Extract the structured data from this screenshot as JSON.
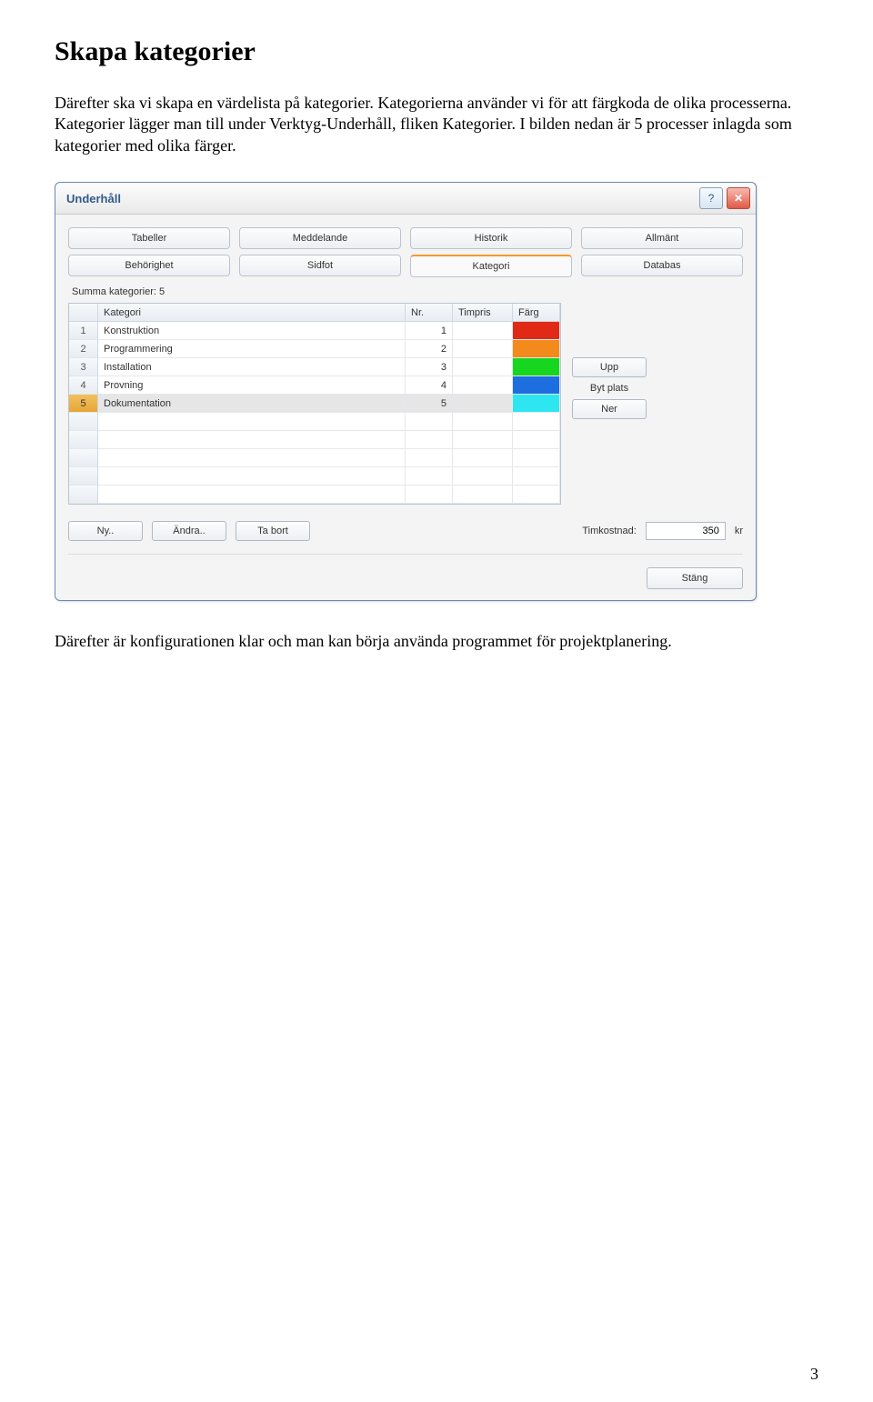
{
  "page_number": "3",
  "heading": "Skapa kategorier",
  "intro": "Därefter ska vi skapa en värdelista på kategorier. Kategorierna använder vi för att färgkoda de olika processerna. Kategorier lägger man till under Verktyg-Underhåll, fliken Kategorier. I  bilden nedan är 5 processer inlagda som kategorier med olika färger.",
  "window": {
    "title": "Underhåll",
    "help_label": "?",
    "close_label": "✕",
    "tabs": {
      "row1": [
        "Tabeller",
        "Meddelande",
        "Historik",
        "Allmänt"
      ],
      "row2": [
        "Behörighet",
        "Sidfot",
        "Kategori",
        "Databas"
      ],
      "active": "Kategori"
    },
    "summa_label": "Summa kategorier: 5",
    "table": {
      "headers": {
        "kategori": "Kategori",
        "nr": "Nr.",
        "timpris": "Timpris",
        "farg": "Färg"
      },
      "rows": [
        {
          "n": "1",
          "kategori": "Konstruktion",
          "nr": "1",
          "timpris": "",
          "color": "#e02a16"
        },
        {
          "n": "2",
          "kategori": "Programmering",
          "nr": "2",
          "timpris": "",
          "color": "#f28a1c"
        },
        {
          "n": "3",
          "kategori": "Installation",
          "nr": "3",
          "timpris": "",
          "color": "#17d61f"
        },
        {
          "n": "4",
          "kategori": "Provning",
          "nr": "4",
          "timpris": "",
          "color": "#1d6fe0"
        },
        {
          "n": "5",
          "kategori": "Dokumentation",
          "nr": "5",
          "timpris": "",
          "color": "#2ee6f0",
          "selected": true
        }
      ],
      "empty_rows": 5
    },
    "side_buttons": {
      "upp": "Upp",
      "byt": "Byt plats",
      "ner": "Ner"
    },
    "bottom": {
      "ny": "Ny..",
      "andra": "Ändra..",
      "tabort": "Ta bort",
      "timkostnad_label": "Timkostnad:",
      "timkostnad_value": "350",
      "kr": "kr"
    },
    "footer": {
      "stang": "Stäng"
    }
  },
  "outro": "Därefter är konfigurationen klar och man kan börja använda programmet för projektplanering."
}
